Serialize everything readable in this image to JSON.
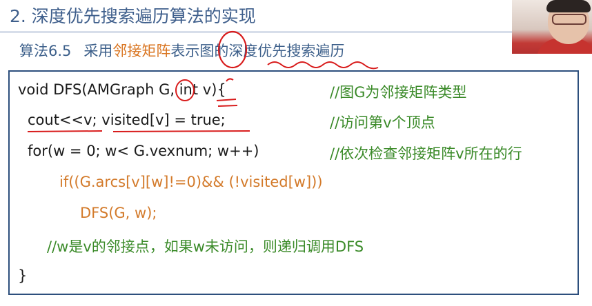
{
  "header": {
    "title": "2. 深度优先搜索遍历算法的实现"
  },
  "subtitle": {
    "number": "算法6.5",
    "prefix": "采用",
    "highlight": "邻接矩阵",
    "suffix": "表示图的深度优先搜索遍历"
  },
  "code": {
    "lines": [
      {
        "text": "void DFS(AMGraph G, int v){",
        "comment": "//图G为邻接矩阵类型"
      },
      {
        "text": "cout<<v;  visited[v] = true;",
        "comment": "//访问第v个顶点"
      },
      {
        "text": "for(w = 0; w< G.vexnum; w++)",
        "comment": "//依次检查邻接矩阵v所在的行"
      },
      {
        "text": "if((G.arcs[v][w]!=0)&& (!visited[w]))"
      },
      {
        "text": "DFS(G, w);"
      },
      {
        "comment": "//w是v的邻接点，如果w未访问，则递归调用DFS"
      },
      {
        "text": "}"
      }
    ]
  },
  "colors": {
    "title": "#3f5f8c",
    "highlight": "#d9741f",
    "comment": "#3a8a28",
    "code_orange": "#d37a2a",
    "annotation": "#d81b1b"
  }
}
